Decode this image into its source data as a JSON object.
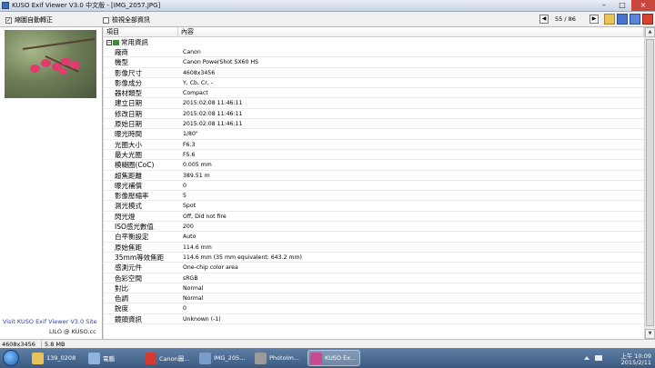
{
  "window": {
    "title": "KUSO Exif Viewer V3.0 中文版 - [IMG_2057.JPG]"
  },
  "toolbar": {
    "auto_rotate_label": "縮圖自動轉正",
    "auto_rotate_checked": true,
    "show_all_label": "檢視全部資訊",
    "show_all_checked": false,
    "counter": "55 / 86"
  },
  "left": {
    "site_link": "Visit KUSO Exif Viewer V3.0 Site",
    "credit": "LILO @ KUSO.cc"
  },
  "table": {
    "col_item": "項目",
    "col_content": "內容",
    "group_label": "常用資訊",
    "rows": [
      {
        "k": "廠商",
        "v": "Canon"
      },
      {
        "k": "機型",
        "v": "Canon PowerShot SX60 HS"
      },
      {
        "k": "影像尺寸",
        "v": "4608x3456"
      },
      {
        "k": "影像成分",
        "v": "Y, Cb, Cr, -"
      },
      {
        "k": "器材類型",
        "v": "Compact"
      },
      {
        "k": "建立日期",
        "v": "2015:02:08 11:46:11"
      },
      {
        "k": "修改日期",
        "v": "2015:02:08 11:46:11"
      },
      {
        "k": "原始日期",
        "v": "2015:02:08 11:46:11"
      },
      {
        "k": "曝光時間",
        "v": "1/80\""
      },
      {
        "k": "光圈大小",
        "v": "F6.3"
      },
      {
        "k": "最大光圈",
        "v": "F5.6"
      },
      {
        "k": "模糊圈(CoC)",
        "v": "0.005 mm"
      },
      {
        "k": "超焦距離",
        "v": "389.51 m"
      },
      {
        "k": "曝光補償",
        "v": "0"
      },
      {
        "k": "影像壓縮率",
        "v": "5"
      },
      {
        "k": "測光模式",
        "v": "Spot"
      },
      {
        "k": "閃光燈",
        "v": "Off, Did not fire"
      },
      {
        "k": "ISO感光數值",
        "v": "200"
      },
      {
        "k": "白平衡設定",
        "v": "Auto"
      },
      {
        "k": "原始焦距",
        "v": "114.6 mm"
      },
      {
        "k": "35mm等效焦距",
        "v": "114.6 mm (35 mm equivalent: 643.2 mm)"
      },
      {
        "k": "感測元件",
        "v": "One-chip color area"
      },
      {
        "k": "色彩空間",
        "v": "sRGB"
      },
      {
        "k": "對比",
        "v": "Normal"
      },
      {
        "k": "色調",
        "v": "Normal"
      },
      {
        "k": "銳度",
        "v": "0"
      },
      {
        "k": "鏡頭資訊",
        "v": "Unknown (-1)"
      }
    ]
  },
  "status": {
    "dimensions": "4608x3456",
    "size": "5.8 MB"
  },
  "taskbar": {
    "items": [
      {
        "label": "139_0208",
        "color": "#e8c35a"
      },
      {
        "label": "電腦",
        "color": "#8fb4dd"
      },
      {
        "label": "Canon圖...",
        "color": "#d23b2f"
      },
      {
        "label": "IMG_205...",
        "color": "#7a9cc9"
      },
      {
        "label": "PhotoIm...",
        "color": "#9b9b9b"
      },
      {
        "label": "KUSO Ex...",
        "color": "#c84a8e"
      }
    ],
    "time": "上午 10:09",
    "date": "2015/2/11"
  }
}
